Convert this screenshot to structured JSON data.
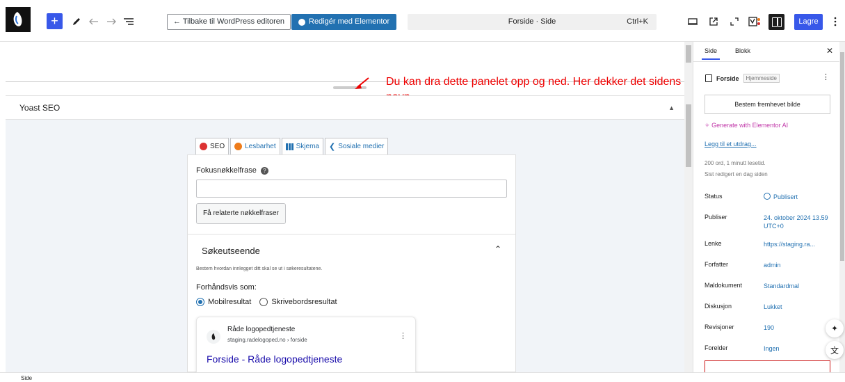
{
  "toolbar": {
    "back_label": "← Tilbake til WordPress editoren",
    "elementor_label": "Redigér med Elementor",
    "doc_title": "Forside · Side",
    "shortcut": "Ctrl+K",
    "save_label": "Lagre"
  },
  "annotation": {
    "text": "Du kan dra dette panelet opp og ned.  Her dekker det sidens navn"
  },
  "yoast": {
    "panel_title": "Yoast SEO",
    "tabs": [
      {
        "label": "SEO",
        "icon": "red-face-icon"
      },
      {
        "label": "Lesbarhet",
        "icon": "orange-face-icon"
      },
      {
        "label": "Skjema",
        "icon": "grid-icon"
      },
      {
        "label": "Sosiale medier",
        "icon": "share-icon"
      }
    ],
    "focus_label": "Fokusnøkkelfrase",
    "focus_value": "",
    "related_button": "Få relaterte nøkkelfraser",
    "section_title": "Søkeutseende",
    "section_desc": "Bestem hvordan innlegget ditt skal se ut i søkeresultatene.",
    "preview_label": "Forhåndsvis som:",
    "radio_mobile": "Mobilresultat",
    "radio_desktop": "Skrivebordsresultat",
    "selected_preview": "mobile",
    "preview": {
      "site_name": "Råde logopedtjeneste",
      "url": "staging.radelogoped.no › forside",
      "title": "Forside - Råde logopedtjeneste"
    }
  },
  "sidebar": {
    "tab_page": "Side",
    "tab_block": "Blokk",
    "doc_name": "Forside",
    "doc_badge": "Hjemmeside",
    "featured_button": "Bestem fremhevet bilde",
    "generate_ai": "Generate with Elementor AI",
    "excerpt_link": "Legg til et utdrag...",
    "meta_line1": "200 ord, 1 minutt lesetid.",
    "meta_line2": "Sist redigert en dag siden",
    "rows": [
      {
        "key": "Status",
        "value": "Publisert"
      },
      {
        "key": "Publiser",
        "value": "24. oktober 2024 13.59 UTC+0"
      },
      {
        "key": "Lenke",
        "value": "https://staging.ra..."
      },
      {
        "key": "Forfatter",
        "value": "admin"
      },
      {
        "key": "Maldokument",
        "value": "Standardmal"
      },
      {
        "key": "Diskusjon",
        "value": "Lukket"
      },
      {
        "key": "Revisjoner",
        "value": "190"
      },
      {
        "key": "Forelder",
        "value": "Ingen"
      }
    ]
  },
  "statusbar": {
    "breadcrumb": "Side"
  },
  "colors": {
    "accent": "#3858e9",
    "wp_blue": "#2271b1",
    "annotation_red": "#e00000"
  }
}
